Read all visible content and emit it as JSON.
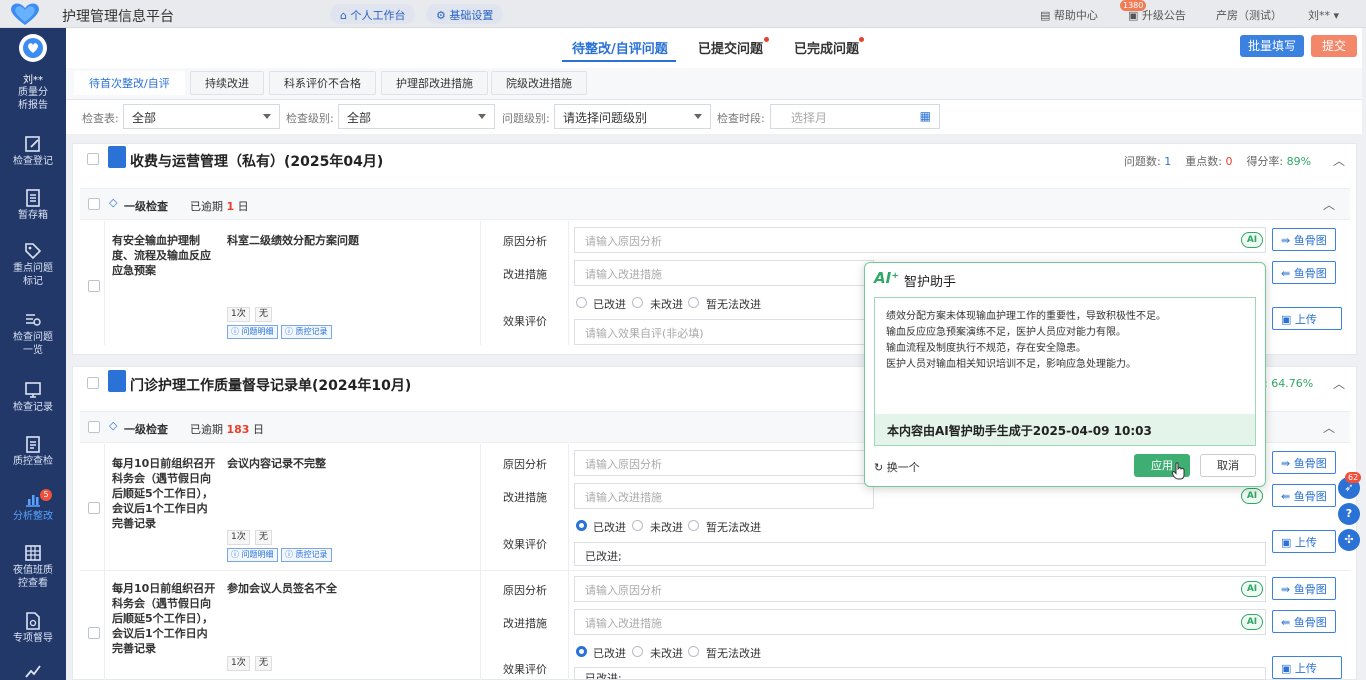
{
  "app": {
    "title": "护理管理信息平台",
    "workspace_label": "个人工作台",
    "settings_label": "基础设置"
  },
  "topbar": {
    "help_label": "帮助中心",
    "notice_count": "1380",
    "notice_label": "升级公告",
    "dept_label": "产房（测试）",
    "user_label": "刘**"
  },
  "sidebar": {
    "user": "刘**",
    "items": [
      {
        "label": "质量分析报告"
      },
      {
        "label": "检查登记"
      },
      {
        "label": "暂存箱"
      },
      {
        "label": "重点问题标记"
      },
      {
        "label": "检查问题一览"
      },
      {
        "label": "检查记录"
      },
      {
        "label": "质控查检"
      },
      {
        "label": "分析整改",
        "badge": "5"
      },
      {
        "label": "夜值班质控查看"
      },
      {
        "label": "专项督导"
      }
    ]
  },
  "main_tabs": [
    {
      "label": "待整改/自评问题"
    },
    {
      "label": "已提交问题"
    },
    {
      "label": "已完成问题"
    }
  ],
  "actions": {
    "batch_label": "批量填写",
    "submit_label": "提交"
  },
  "sub_tabs": [
    {
      "label": "待首次整改/自评"
    },
    {
      "label": "持续改进"
    },
    {
      "label": "科系评价不合格"
    },
    {
      "label": "护理部改进措施"
    },
    {
      "label": "院级改进措施"
    }
  ],
  "filters": {
    "table_label": "检查表:",
    "table_value": "全部",
    "level_label": "检查级别:",
    "level_value": "全部",
    "issue_level_label": "问题级别:",
    "issue_level_value": "请选择问题级别",
    "period_label": "检查时段:",
    "period_placeholder": "选择月"
  },
  "common": {
    "cause_label": "原因分析",
    "measure_label": "改进措施",
    "effect_label": "效果评价",
    "cause_placeholder": "请输入原因分析",
    "measure_placeholder": "请输入改进措施",
    "effect_placeholder": "请输入效果自评(非必填)",
    "opt_improved": "已改进",
    "opt_not_improved": "未改进",
    "opt_cannot": "暂无法改进",
    "fishbone_label": "鱼骨图",
    "upload_label": "上传",
    "level_one": "一级检查",
    "overdue_label": "已逾期",
    "day_unit": "日",
    "count_tag": "1次",
    "none_tag": "无",
    "detail_tag": "问题明细",
    "record_tag": "质控记录",
    "ai_chip": "AI"
  },
  "card1": {
    "title": "收费与运营管理（私有）(2025年04月)",
    "issues_label": "问题数:",
    "issues_value": "1",
    "key_label": "重点数:",
    "key_value": "0",
    "score_label": "得分率:",
    "score_value": "89%",
    "overdue_days": "1",
    "item": {
      "standard": "有安全输血护理制度、流程及输血反应应急预案",
      "problem": "科室二级绩效分配方案问题"
    }
  },
  "card2": {
    "title": "门诊护理工作质量督导记录单(2024年10月)",
    "score_value": ": 64.76%",
    "overdue_days": "183",
    "items": [
      {
        "standard": "每月10日前组织召开科务会（遇节假日向后顺延5个工作日），会议后1个工作日内完善记录",
        "problem": "会议内容记录不完整",
        "effect_value": "已改进;"
      },
      {
        "standard": "每月10日前组织召开科务会（遇节假日向后顺延5个工作日），会议后1个工作日内完善记录",
        "problem": "参加会议人员签名不全",
        "effect_value": "已改进;"
      }
    ]
  },
  "ai_popup": {
    "title": "智护助手",
    "logo": "AI⁺",
    "lines": [
      "绩效分配方案未体现输血护理工作的重要性，导致积极性不足。",
      "输血反应应急预案演练不足，医护人员应对能力有限。",
      "输血流程及制度执行不规范，存在安全隐患。",
      "医护人员对输血相关知识培训不足，影响应急处理能力。"
    ],
    "footer": "本内容由AI智护助手生成于2025-04-09 10:03",
    "refresh_label": "换一个",
    "apply_label": "应用",
    "cancel_label": "取消"
  },
  "float": {
    "badge": "62"
  },
  "colors": {
    "primary": "#2a72d6",
    "sidebar": "#223868",
    "ai_green": "#3fae72",
    "danger": "#e8402c"
  }
}
